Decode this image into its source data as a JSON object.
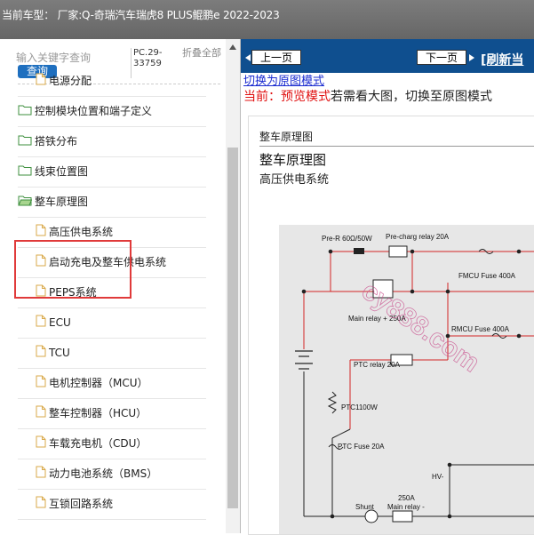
{
  "header": {
    "title": "当前车型： 厂家:Q-奇瑞汽车瑞虎8 PLUS鲲鹏e 2022-2023"
  },
  "search": {
    "placeholder": "输入关键字查询",
    "button": "查询",
    "code": "PC.29-33759",
    "collapse": "折叠全部"
  },
  "tree": [
    {
      "label": "电源分配",
      "type": "doc"
    },
    {
      "label": "控制模块位置和端子定义",
      "type": "folder"
    },
    {
      "label": "搭铁分布",
      "type": "folder"
    },
    {
      "label": "线束位置图",
      "type": "folder"
    },
    {
      "label": "整车原理图",
      "type": "folder-open"
    },
    {
      "label": "高压供电系统",
      "type": "doc"
    },
    {
      "label": "启动充电及整车供电系统",
      "type": "doc"
    },
    {
      "label": "PEPS系统",
      "type": "doc"
    },
    {
      "label": "ECU",
      "type": "doc"
    },
    {
      "label": "TCU",
      "type": "doc"
    },
    {
      "label": "电机控制器（MCU）",
      "type": "doc"
    },
    {
      "label": "整车控制器（HCU）",
      "type": "doc"
    },
    {
      "label": "车载充电机（CDU）",
      "type": "doc"
    },
    {
      "label": "动力电池系统（BMS）",
      "type": "doc"
    },
    {
      "label": "互锁回路系统",
      "type": "doc"
    }
  ],
  "nav": {
    "prev": "上一页",
    "next": "下一页",
    "refresh": "[刷新当"
  },
  "view": {
    "switch_link": "切换为原图模式",
    "mode_prefix": "当前：",
    "mode_name": "预览模式",
    "mode_tail": "若需看大图，切换至原图模式"
  },
  "doc": {
    "breadcrumb": "整车原理图",
    "title": "整车原理图",
    "subtitle": "高压供电系统"
  },
  "diagram": {
    "labels": {
      "pre_r": "Pre-R 60Ω/50W",
      "pre_relay": "Pre-charg relay 20A",
      "fmcu": "FMCU Fuse 400A",
      "main_relay": "Main relay + 250A",
      "rmcu": "RMCU Fuse 400A",
      "ptc_relay": "PTC relay 20A",
      "ptc": "PTC1100W",
      "ptc_fuse": "PTC Fuse 20A",
      "hv": "HV-",
      "shunt": "Shunt",
      "main_relay_neg_top": "250A",
      "main_relay_neg": "Main relay -"
    },
    "watermark": "cy888.com"
  },
  "colors": {
    "accent": "#0f4f8f",
    "highlight": "#e03a3a",
    "folder": "#3e8f3e",
    "doc": "#d9a94a",
    "wire": "#d32626"
  }
}
